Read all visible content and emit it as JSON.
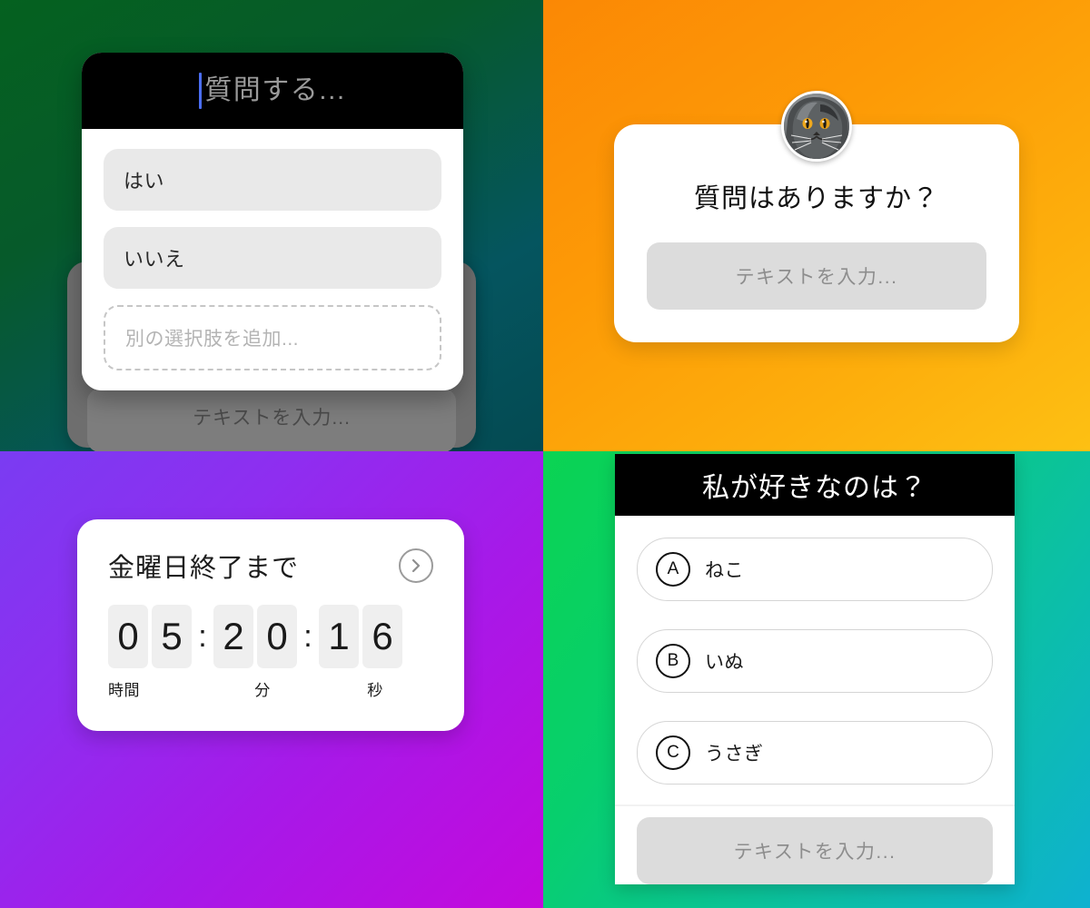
{
  "panels": {
    "poll": {
      "name": "poll-sticker",
      "background": {
        "from": "#05611f",
        "to": "#044a52"
      },
      "question_placeholder": "質問する...",
      "options": [
        {
          "label": "はい"
        },
        {
          "label": "いいえ"
        }
      ],
      "add_option_placeholder": "別の選択肢を追加...",
      "behind_input_placeholder": "テキストを入力..."
    },
    "question": {
      "name": "question-sticker",
      "background": {
        "from": "#fb8805",
        "to": "#fdc013"
      },
      "avatar": "cat-avatar",
      "title": "質問はありますか？",
      "input_placeholder": "テキストを入力..."
    },
    "countdown": {
      "name": "countdown-sticker",
      "background": {
        "from": "#7a3cf2",
        "to": "#c409dc"
      },
      "title": "金曜日終了まで",
      "chevron_icon": "chevron-right-icon",
      "digits": {
        "hours": [
          "0",
          "5"
        ],
        "minutes": [
          "2",
          "0"
        ],
        "seconds": [
          "1",
          "6"
        ],
        "separator": ":"
      },
      "units": {
        "hours": "時間",
        "minutes": "分",
        "seconds": "秒"
      }
    },
    "quiz": {
      "name": "quiz-sticker",
      "background": {
        "from": "#0bd352",
        "to": "#0eb1d0"
      },
      "title": "私が好きなのは？",
      "options": [
        {
          "badge": "A",
          "label": "ねこ"
        },
        {
          "badge": "B",
          "label": "いぬ"
        },
        {
          "badge": "C",
          "label": "うさぎ"
        }
      ],
      "input_placeholder": "テキストを入力..."
    }
  }
}
